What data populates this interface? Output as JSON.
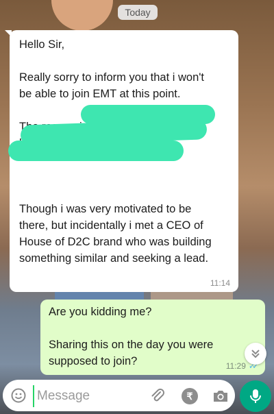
{
  "date_divider": "Today",
  "incoming": {
    "lines": [
      "Hello Sir,",
      "",
      "Really sorry to inform you that i won't",
      "be able to join EMT at this point.",
      "",
      "The reason is by god's grace i",
      "have gotten a",
      "",
      "",
      "",
      "Though i was very motivated to be",
      "there, but incidentally i met a CEO of",
      "House of D2C brand who was building",
      "something similar and seeking a lead."
    ],
    "time": "11:14"
  },
  "outgoing": {
    "lines": [
      "Are you kidding me?",
      "",
      "Sharing this on the day you were",
      "supposed to join?"
    ],
    "time": "11:29",
    "status": "read"
  },
  "composer": {
    "placeholder": "Message",
    "rupee_symbol": "₹"
  },
  "colors": {
    "accent": "#00a884",
    "outgoing_bubble": "#e1fdc9",
    "redaction": "#3ee6b0",
    "read_ticks": "#4fb6ec"
  },
  "icons": [
    "emoji-icon",
    "attach-icon",
    "rupee-icon",
    "camera-icon",
    "mic-icon",
    "chevron-double-down-icon",
    "double-check-icon"
  ]
}
